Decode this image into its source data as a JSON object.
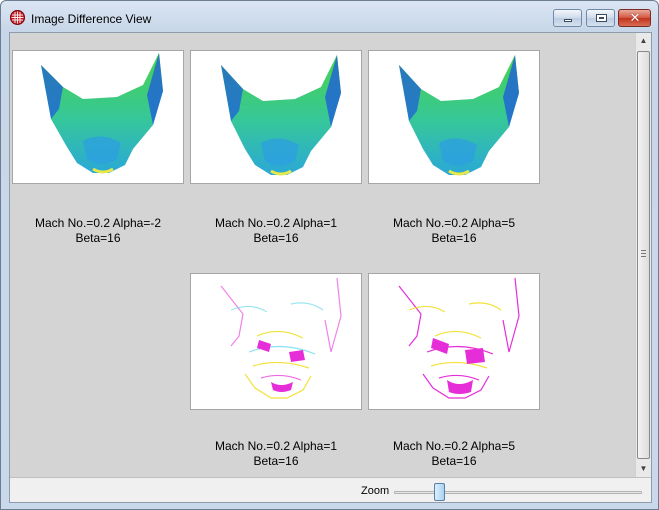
{
  "window": {
    "title": "Image Difference View",
    "close_glyph": "✕",
    "icons": {
      "app": "grid-globe-icon",
      "minimize": "minimize-icon",
      "maximize": "maximize-icon",
      "close": "close-icon",
      "scroll_up": "arrow-up-icon",
      "scroll_down": "arrow-down-icon"
    }
  },
  "scroll": {
    "up_glyph": "▲",
    "down_glyph": "▼"
  },
  "top_row": [
    {
      "caption_line1": "Mach No.=0.2  Alpha=-2",
      "caption_line2": "Beta=16"
    },
    {
      "caption_line1": "Mach No.=0.2  Alpha=1",
      "caption_line2": "Beta=16"
    },
    {
      "caption_line1": "Mach No.=0.2  Alpha=5",
      "caption_line2": "Beta=16"
    }
  ],
  "diff_row": [
    {
      "caption_line1": "Mach No.=0.2  Alpha=1",
      "caption_line2": "Beta=16"
    },
    {
      "caption_line1": "Mach No.=0.2  Alpha=5",
      "caption_line2": "Beta=16"
    }
  ],
  "zoom": {
    "label": "Zoom",
    "value_fraction": 0.17
  },
  "colors": {
    "surface_green": "#3fd14a",
    "surface_blue": "#1f5fd8",
    "diff_magenta": "#e62ed8",
    "diff_yellow": "#f2e23a",
    "diff_cyan": "#5bd6e8"
  }
}
